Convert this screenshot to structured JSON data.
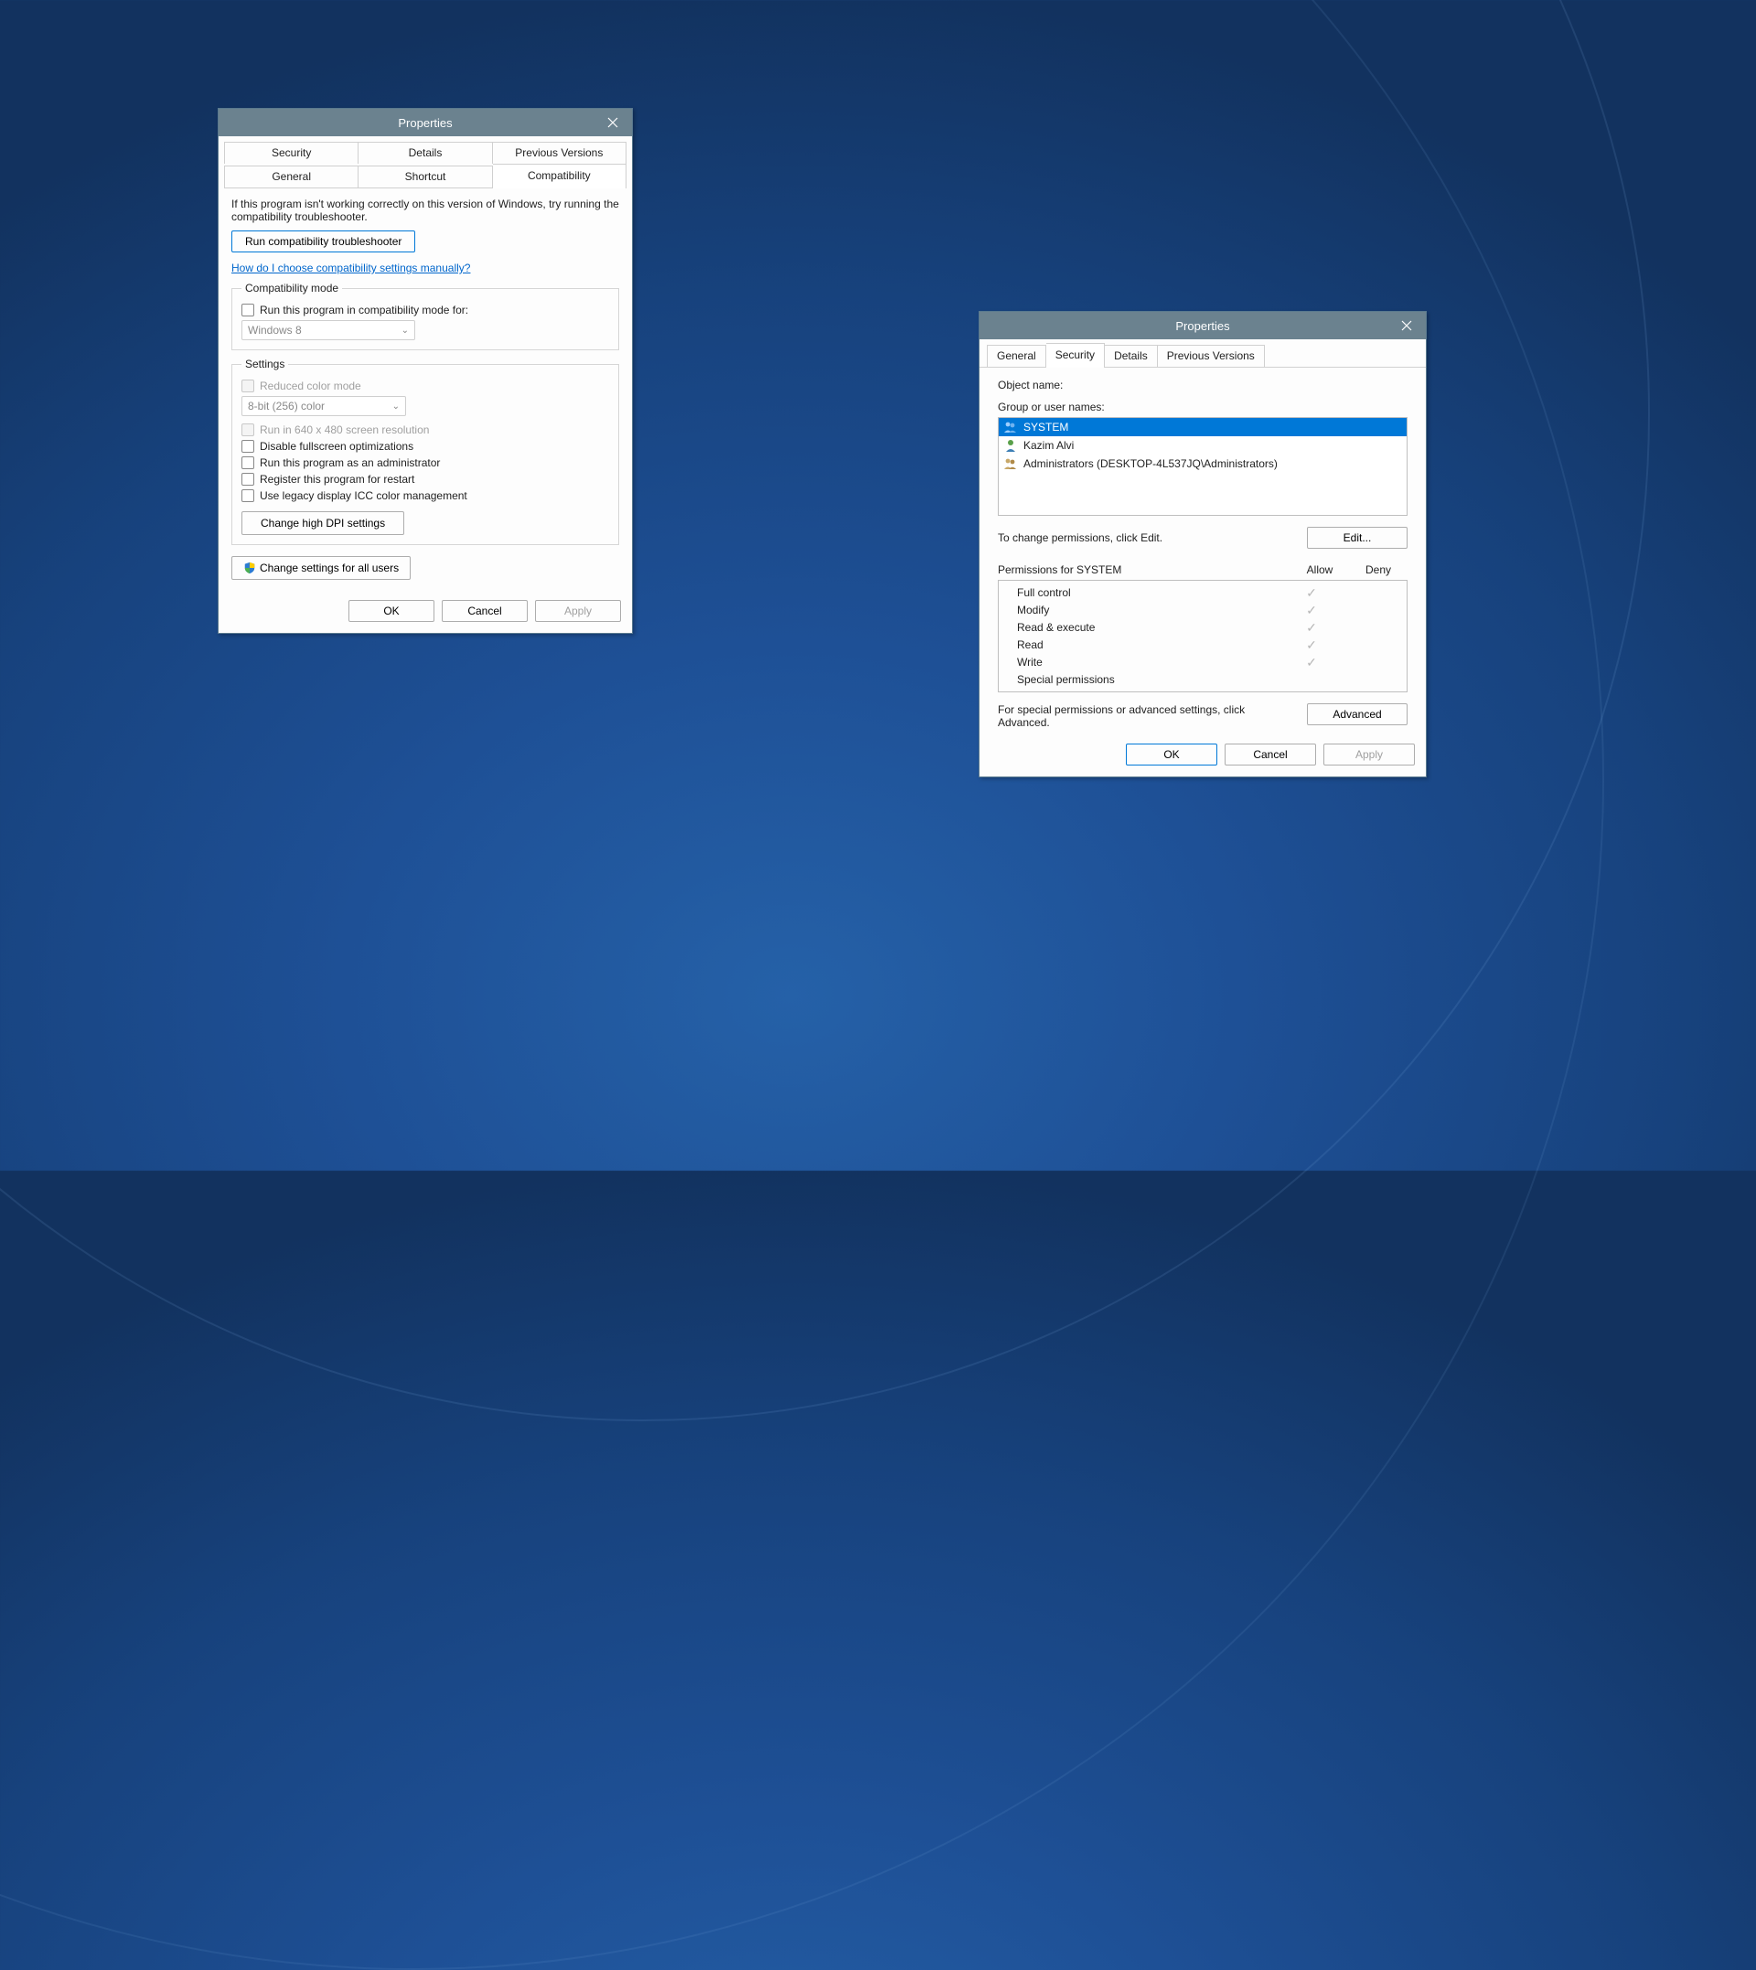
{
  "compat": {
    "title": "Properties",
    "tabs_row1": [
      "Security",
      "Details",
      "Previous Versions"
    ],
    "tabs_row2": [
      "General",
      "Shortcut",
      "Compatibility"
    ],
    "intro": "If this program isn't working correctly on this version of Windows, try running the compatibility troubleshooter.",
    "run_troubleshooter": "Run compatibility troubleshooter",
    "manual_link": "How do I choose compatibility settings manually?",
    "compat_mode_legend": "Compatibility mode",
    "compat_check": "Run this program in compatibility mode for:",
    "compat_select": "Windows 8",
    "settings_legend": "Settings",
    "reduced_color": "Reduced color mode",
    "color_select": "8-bit (256) color",
    "run_640": "Run in 640 x 480 screen resolution",
    "disable_fullscreen": "Disable fullscreen optimizations",
    "run_admin": "Run this program as an administrator",
    "register_restart": "Register this program for restart",
    "legacy_icc": "Use legacy display ICC color management",
    "change_dpi": "Change high DPI settings",
    "change_all_users": "Change settings for all users",
    "ok": "OK",
    "cancel": "Cancel",
    "apply": "Apply"
  },
  "security": {
    "title": "Properties",
    "tabs": [
      "General",
      "Security",
      "Details",
      "Previous Versions"
    ],
    "object_name_label": "Object name:",
    "group_label": "Group or user names:",
    "users": [
      {
        "name": "SYSTEM",
        "icon": "group"
      },
      {
        "name": "Kazim Alvi",
        "icon": "user"
      },
      {
        "name": "Administrators (DESKTOP-4L537JQ\\Administrators)",
        "icon": "group"
      }
    ],
    "change_hint": "To change permissions, click Edit.",
    "edit": "Edit...",
    "perm_header": "Permissions for SYSTEM",
    "allow": "Allow",
    "deny": "Deny",
    "perms": [
      {
        "name": "Full control",
        "allow": true
      },
      {
        "name": "Modify",
        "allow": true
      },
      {
        "name": "Read & execute",
        "allow": true
      },
      {
        "name": "Read",
        "allow": true
      },
      {
        "name": "Write",
        "allow": true
      },
      {
        "name": "Special permissions",
        "allow": false
      }
    ],
    "advanced_hint": "For special permissions or advanced settings, click Advanced.",
    "advanced": "Advanced",
    "ok": "OK",
    "cancel": "Cancel",
    "apply": "Apply"
  }
}
